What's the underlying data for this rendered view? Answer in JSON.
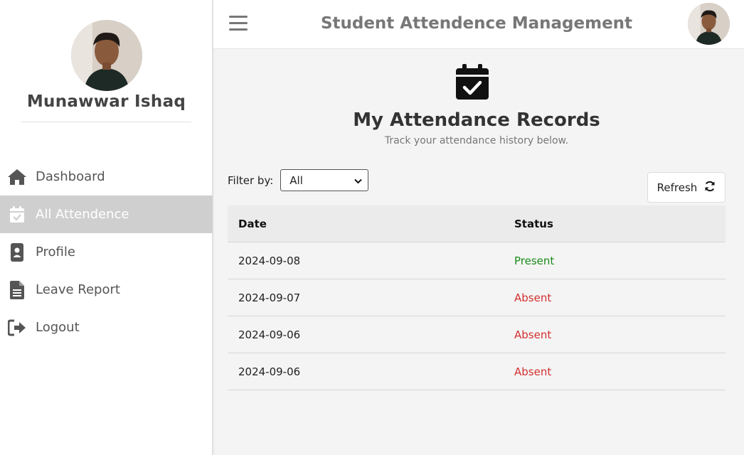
{
  "sidebar": {
    "user_name": "Munawwar Ishaq",
    "items": [
      {
        "label": "Dashboard",
        "icon": "home-icon"
      },
      {
        "label": "All Attendence",
        "icon": "calendar-check-icon",
        "active": true
      },
      {
        "label": "Profile",
        "icon": "id-badge-icon"
      },
      {
        "label": "Leave Report",
        "icon": "document-icon"
      },
      {
        "label": "Logout",
        "icon": "logout-icon"
      }
    ]
  },
  "header": {
    "title": "Student Attendence Management"
  },
  "main": {
    "title": "My Attendance Records",
    "subtitle": "Track your attendance history below.",
    "filter_label": "Filter by:",
    "filter_value": "All",
    "refresh_label": "Refresh",
    "table": {
      "headers": [
        "Date",
        "Status"
      ],
      "rows": [
        {
          "date": "2024-09-08",
          "status": "Present"
        },
        {
          "date": "2024-09-07",
          "status": "Absent"
        },
        {
          "date": "2024-09-06",
          "status": "Absent"
        },
        {
          "date": "2024-09-06",
          "status": "Absent"
        }
      ]
    }
  },
  "colors": {
    "present": "#1a8a1a",
    "absent": "#d32f2f",
    "active_nav_bg": "#cfcfcf",
    "icon_gray": "#555555"
  }
}
